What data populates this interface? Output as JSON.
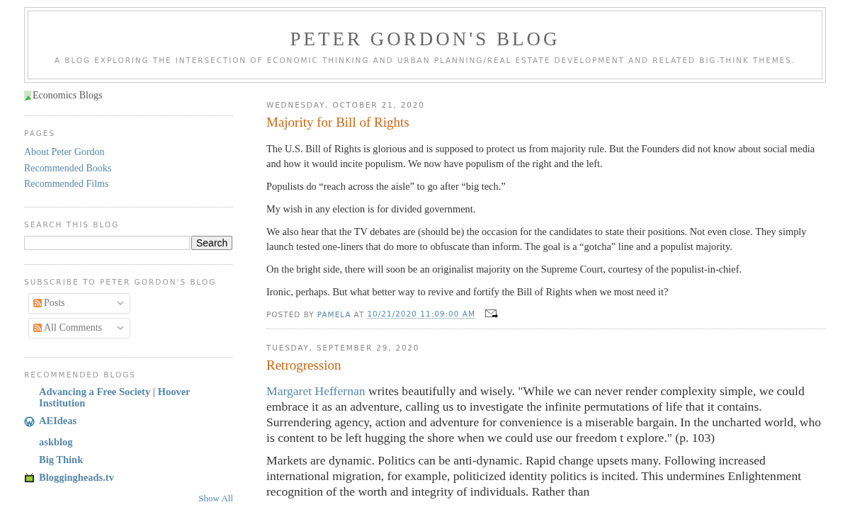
{
  "header": {
    "title": "PETER GORDON'S BLOG",
    "description": "A BLOG EXPLORING THE INTERSECTION OF ECONOMIC THINKING AND URBAN PLANNING/REAL ESTATE DEVELOPMENT AND RELATED BIG-THINK THEMES."
  },
  "sidebar": {
    "image_alt": "Economics Blogs",
    "pages": {
      "heading": "PAGES",
      "items": [
        "About Peter Gordon",
        "Recommended Books",
        "Recommended Films"
      ]
    },
    "search": {
      "heading": "SEARCH THIS BLOG",
      "button": "Search"
    },
    "subscribe": {
      "heading": "SUBSCRIBE TO PETER GORDON'S BLOG",
      "items": [
        "Posts",
        "All Comments"
      ]
    },
    "blogs": {
      "heading": "RECOMMENDED BLOGS",
      "items": [
        {
          "name": "Advancing a Free Society | Hoover Institution",
          "kind": "plain"
        },
        {
          "name": "AEIdeas",
          "kind": "wordpress"
        },
        {
          "name": "askblog",
          "kind": "plain"
        },
        {
          "name": "Big Think",
          "kind": "plain"
        },
        {
          "name": "Bloggingheads.tv",
          "kind": "tv"
        }
      ],
      "show_all": "Show All"
    }
  },
  "posts": [
    {
      "date": "WEDNESDAY, OCTOBER 21, 2020",
      "title": "Majority for Bill of Rights",
      "paragraphs": [
        {
          "text": " The U.S. Bill of Rights is glorious and is supposed to protect us from majority rule. But the Founders did not know about social media and how it would incite populism. We now have populism of the right and the left."
        },
        {
          "text": "Populists do “reach across the aisle” to go after “big tech.”"
        },
        {
          "text": "My wish in any election is for divided government."
        },
        {
          "text": "We also hear that the TV debates are (should be) the occasion for the candidates to state their positions. Not even close. They simply launch tested one-liners that do more to obfuscate than inform. The goal is a “gotcha” line and a populist majority."
        },
        {
          "text": "On the bright side, there will soon be an originalist majority on the Supreme Court, courtesy of the populist-in-chief."
        },
        {
          "text": "Ironic, perhaps. But what better way to revive and fortify the Bill of Rights when we most need it?"
        }
      ],
      "footer": {
        "posted_by": "POSTED BY",
        "author": "PAMELA",
        "at": "AT",
        "timestamp": "10/21/2020 11:09:00 AM"
      }
    },
    {
      "date": "TUESDAY, SEPTEMBER 29, 2020",
      "title": "Retrogression",
      "paragraphs": [
        {
          "link": "Margaret Heffernan",
          "text": " writes beautifully and wisely. \"While we can never render complexity simple, we could embrace it as an adventure, calling us to investigate the infinite permutations of life that it contains. Surrendering agency, action and adventure for convenience is a miserable bargain. In the uncharted world, who is content to be left hugging the shore when we could use our freedom t explore.\" (p. 103)"
        },
        {
          "text": "Markets are dynamic. Politics can be anti-dynamic. Rapid change upsets many. Following increased international migration, for example, politicized identity politics is incited. This undermines Enlightenment recognition of the worth and integrity of individuals. Rather than"
        }
      ]
    }
  ]
}
